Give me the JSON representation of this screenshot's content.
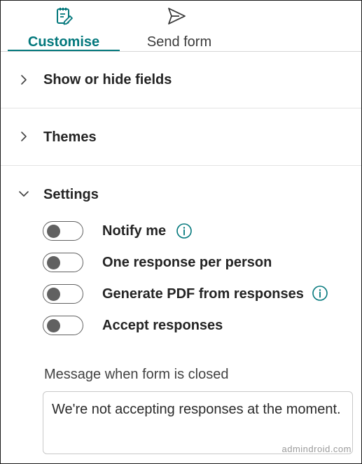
{
  "tabs": [
    {
      "label": "Customise",
      "icon": "form-edit-icon",
      "active": true
    },
    {
      "label": "Send form",
      "icon": "send-icon",
      "active": false
    }
  ],
  "sections": {
    "fields": {
      "title": "Show or hide fields",
      "expanded": false
    },
    "themes": {
      "title": "Themes",
      "expanded": false
    },
    "settings": {
      "title": "Settings",
      "expanded": true
    }
  },
  "settings_items": [
    {
      "label": "Notify me",
      "on": false,
      "has_info": true
    },
    {
      "label": "One response per person",
      "on": false,
      "has_info": false
    },
    {
      "label": "Generate PDF from responses",
      "on": false,
      "has_info": true
    },
    {
      "label": "Accept responses",
      "on": false,
      "has_info": false
    }
  ],
  "closed_message": {
    "label": "Message when form is closed",
    "value": "We're not accepting responses at the moment."
  },
  "watermark": "admindroid.com",
  "colors": {
    "accent": "#03787c",
    "toggle_off": "#616161",
    "text": "#242424"
  }
}
